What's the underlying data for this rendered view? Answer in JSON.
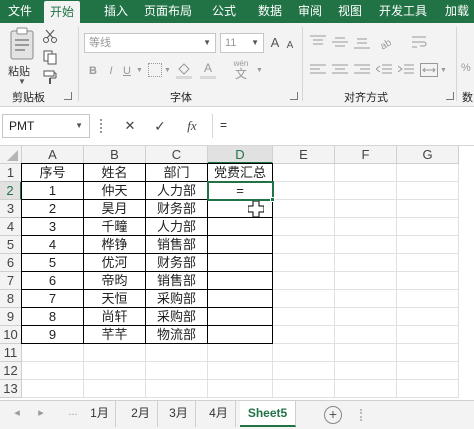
{
  "ribbon": {
    "tabs": [
      {
        "label": "文件",
        "active": false
      },
      {
        "label": "开始",
        "active": true
      },
      {
        "label": "插入",
        "active": false
      },
      {
        "label": "页面布局",
        "active": false
      },
      {
        "label": "公式",
        "active": false
      },
      {
        "label": "数据",
        "active": false
      },
      {
        "label": "审阅",
        "active": false
      },
      {
        "label": "视图",
        "active": false
      },
      {
        "label": "开发工具",
        "active": false
      },
      {
        "label": "加载",
        "active": false
      }
    ],
    "paste_label": "粘贴",
    "font_name": "等线",
    "font_size": "11",
    "font_size_up": "A",
    "font_size_down": "A",
    "bold": "B",
    "italic": "I",
    "underline": "U",
    "font_color": "A",
    "wen_label": "wén",
    "wen_char": "文",
    "groups": {
      "clipboard": "剪贴板",
      "font": "字体",
      "alignment": "对齐方式",
      "number_short": "数"
    },
    "accent": "#217346"
  },
  "formula_bar": {
    "name_box": "PMT",
    "cancel": "✕",
    "enter": "✓",
    "fx": "fx",
    "content": "="
  },
  "grid": {
    "columns": [
      "A",
      "B",
      "C",
      "D",
      "E",
      "F",
      "G"
    ],
    "rows": [
      "1",
      "2",
      "3",
      "4",
      "5",
      "6",
      "7",
      "8",
      "9",
      "10",
      "11",
      "12",
      "13"
    ],
    "selected_column": "D",
    "selected_row": "2",
    "active_cell": "D2",
    "cells": [
      [
        "序号",
        "姓名",
        "部门",
        "党费汇总"
      ],
      [
        "1",
        "仲天",
        "人力部",
        "="
      ],
      [
        "2",
        "昊月",
        "财务部",
        ""
      ],
      [
        "3",
        "千疃",
        "人力部",
        ""
      ],
      [
        "4",
        "桦铮",
        "销售部",
        ""
      ],
      [
        "5",
        "优河",
        "财务部",
        ""
      ],
      [
        "6",
        "帝昀",
        "销售部",
        ""
      ],
      [
        "7",
        "天恒",
        "采购部",
        ""
      ],
      [
        "8",
        "尚轩",
        "采购部",
        ""
      ],
      [
        "9",
        "芊芊",
        "物流部",
        ""
      ]
    ]
  },
  "sheets": {
    "nav_prev": "◂",
    "nav_next": "▸",
    "more": "...",
    "tabs": [
      {
        "label": "1月",
        "active": false
      },
      {
        "label": "2月",
        "active": false
      },
      {
        "label": "3月",
        "active": false
      },
      {
        "label": "4月",
        "active": false
      },
      {
        "label": "Sheet5",
        "active": true
      }
    ],
    "add": "+"
  }
}
